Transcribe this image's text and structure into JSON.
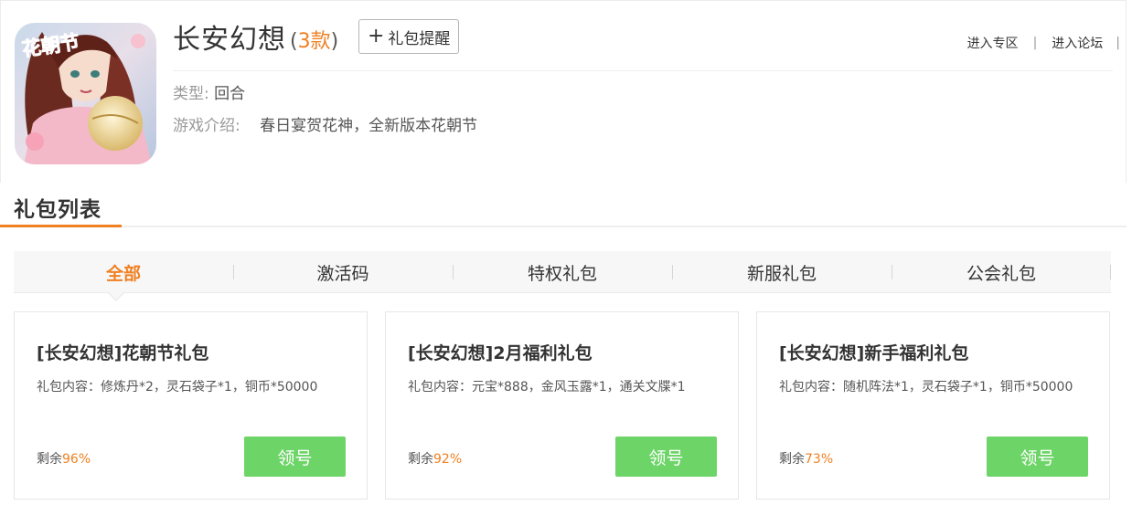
{
  "game": {
    "icon_label": "花朝节",
    "title": "长安幻想",
    "count_open": "(",
    "count": "3款",
    "count_close": ")",
    "remind_plus": "+",
    "remind_label": "礼包提醒",
    "links": [
      "进入专区",
      "进入论坛"
    ],
    "link_separator": "|",
    "type_label": "类型:",
    "type_value": "回合",
    "intro_label": "游戏介绍:",
    "intro_value": "春日宴贺花神，全新版本花朝节"
  },
  "section": {
    "title": "礼包列表"
  },
  "tabs": [
    {
      "label": "全部",
      "active": true
    },
    {
      "label": "激活码",
      "active": false
    },
    {
      "label": "特权礼包",
      "active": false
    },
    {
      "label": "新服礼包",
      "active": false
    },
    {
      "label": "公会礼包",
      "active": false
    }
  ],
  "gifts": [
    {
      "title": "[长安幻想]花朝节礼包",
      "content": "礼包内容：修炼丹*2，灵石袋子*1，铜币*50000",
      "remain_label": "剩余",
      "remain_pct": "96%",
      "button": "领号"
    },
    {
      "title": "[长安幻想]2月福利礼包",
      "content": "礼包内容：元宝*888，金风玉露*1，通关文牒*1",
      "remain_label": "剩余",
      "remain_pct": "92%",
      "button": "领号"
    },
    {
      "title": "[长安幻想]新手福利礼包",
      "content": "礼包内容：随机阵法*1，灵石袋子*1，铜币*50000",
      "remain_label": "剩余",
      "remain_pct": "73%",
      "button": "领号"
    }
  ],
  "colors": {
    "accent": "#f08123",
    "claim_button": "#6dd468"
  }
}
